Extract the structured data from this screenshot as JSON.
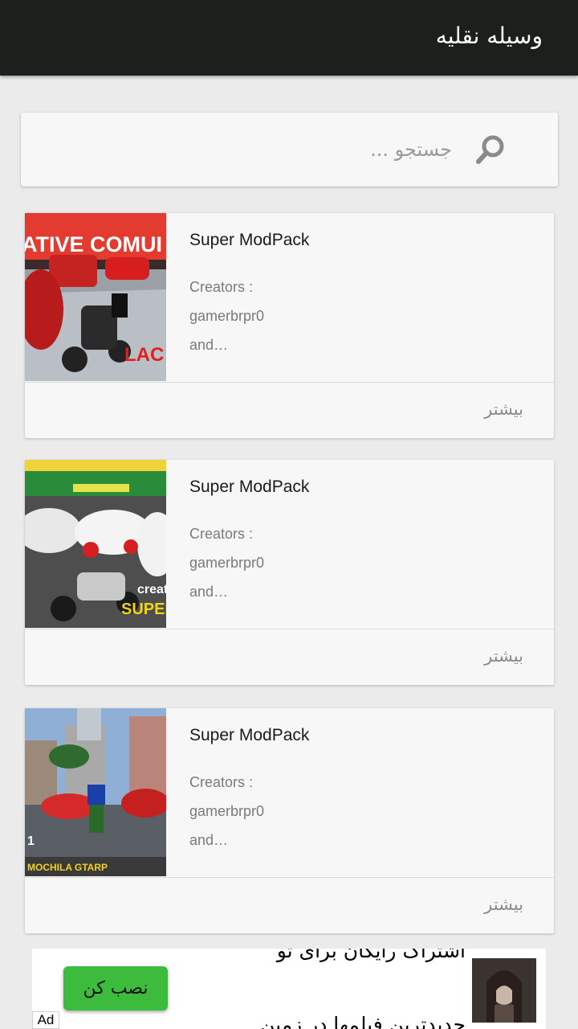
{
  "app_bar": {
    "title": "وسیله نقلیه"
  },
  "search": {
    "placeholder": "جستجو ..."
  },
  "cards": [
    {
      "title": "Super ModPack",
      "desc_line1": "Creators :",
      "desc_line2": "gamerbrpr0",
      "desc_line3": "and…",
      "more_label": "بیشتر",
      "thumb_text1": "ATIVE COMUI",
      "thumb_text2": "LAC"
    },
    {
      "title": "Super ModPack",
      "desc_line1": "Creators :",
      "desc_line2": "gamerbrpr0",
      "desc_line3": "and…",
      "more_label": "بیشتر",
      "thumb_text1": "creat",
      "thumb_text2": "SUPER"
    },
    {
      "title": "Super ModPack",
      "desc_line1": "Creators :",
      "desc_line2": "gamerbrpr0",
      "desc_line3": "and…",
      "more_label": "بیشتر",
      "thumb_text1": "MOCHILA GTARP",
      "thumb_text2": "1"
    }
  ],
  "ad": {
    "line1": "اشتراک رایگان برای تو",
    "line2": "جدیدترین فیلمها در زمین",
    "install_label": "نصب کن",
    "ad_label": "Ad"
  },
  "colors": {
    "app_bar": "#1c201c",
    "background": "#ebebeb",
    "card": "#f7f7f7",
    "install_button": "#3dbb3d"
  }
}
